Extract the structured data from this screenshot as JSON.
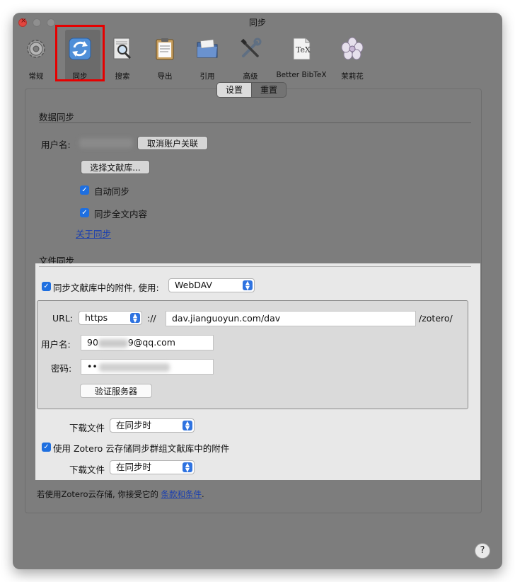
{
  "window": {
    "title": "同步"
  },
  "toolbar": {
    "items": [
      {
        "label": "常规",
        "icon": "gear-icon"
      },
      {
        "label": "同步",
        "icon": "sync-icon"
      },
      {
        "label": "搜索",
        "icon": "search-icon"
      },
      {
        "label": "导出",
        "icon": "clipboard-icon"
      },
      {
        "label": "引用",
        "icon": "folder-icon"
      },
      {
        "label": "高级",
        "icon": "tools-icon"
      },
      {
        "label": "Better BibTeX",
        "icon": "tex-icon"
      },
      {
        "label": "茉莉花",
        "icon": "jasmine-flower-icon"
      }
    ],
    "selected": "同步"
  },
  "tabs": {
    "settings": "设置",
    "reset": "重置"
  },
  "data_sync": {
    "heading": "数据同步",
    "username_label": "用户名:",
    "unlink_button": "取消账户关联",
    "choose_library_button": "选择文献库...",
    "auto_sync_label": "自动同步",
    "sync_fulltext_label": "同步全文内容",
    "about_link": "关于同步"
  },
  "file_sync": {
    "heading": "文件同步",
    "sync_attachments_label": "同步文献库中的附件, 使用:",
    "method": "WebDAV",
    "url_label": "URL:",
    "protocol": "https",
    "separator": "://",
    "url_value": "dav.jianguoyun.com/dav",
    "url_suffix": "/zotero/",
    "username_label": "用户名:",
    "username_prefix": "90",
    "username_suffix": "9@qq.com",
    "password_label": "密码:",
    "password_mask": "••",
    "verify_button": "验证服务器",
    "download_label": "下载文件",
    "download_value": "在同步时",
    "group_sync_label": "使用 Zotero 云存储同步群组文献库中的附件",
    "group_download_label": "下载文件",
    "group_download_value": "在同步时"
  },
  "footer": {
    "terms_prefix": "若使用Zotero云存储, 你接受它的 ",
    "terms_link": "条款和条件",
    "terms_suffix": "."
  },
  "help_button": "?"
}
